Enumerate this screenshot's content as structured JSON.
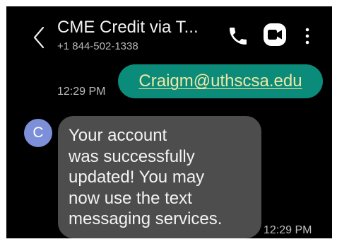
{
  "header": {
    "back_icon": "chevron-left-icon",
    "title": "CME Credit via T...",
    "subtitle": "+1 844-502-1338",
    "call_icon": "phone-icon",
    "video_icon": "video-call-icon",
    "more_icon": "more-vertical-icon"
  },
  "messages": [
    {
      "direction": "outgoing",
      "time": "12:29 PM",
      "text": "Craigm@uthscsa.edu",
      "bubble_color": "#0b8c7b",
      "link_color": "#f1e6a3"
    },
    {
      "direction": "incoming",
      "avatar_initial": "C",
      "avatar_color": "#7d8fd8",
      "time": "12:29 PM",
      "text": "Your account\nwas successfully\nupdated!  You may\nnow use the text\nmessaging services.",
      "bubble_color": "#4d4d4d"
    }
  ]
}
